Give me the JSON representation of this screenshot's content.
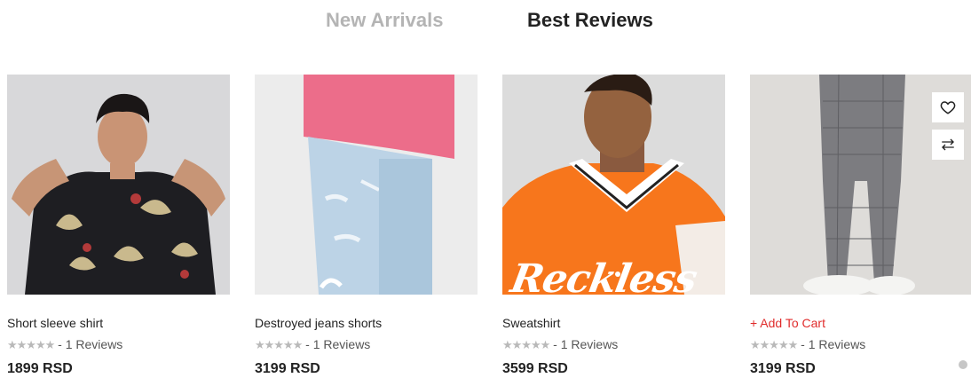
{
  "tabs": [
    {
      "label": "New Arrivals",
      "active": false
    },
    {
      "label": "Best Reviews",
      "active": true
    }
  ],
  "products": [
    {
      "name": "Short sleeve shirt",
      "stars": "★★★★★",
      "reviews": "- 1 Reviews",
      "price": "1899 RSD"
    },
    {
      "name": "Destroyed jeans shorts",
      "stars": "★★★★★",
      "reviews": "- 1 Reviews",
      "price": "3199 RSD"
    },
    {
      "name": "Sweatshirt",
      "stars": "★★★★★",
      "reviews": "- 1 Reviews",
      "price": "3599 RSD",
      "image_text": "Reckless"
    },
    {
      "name": "+ Add To Cart",
      "stars": "★★★★★",
      "reviews": "- 1 Reviews",
      "price": "3199 RSD"
    }
  ],
  "icons": {
    "wishlist": "heart-icon",
    "compare": "compare-arrows-icon"
  },
  "colors": {
    "add_to_cart": "#e02c2c",
    "inactive_tab": "#b4b4b4",
    "stars": "#b9b9b9"
  }
}
